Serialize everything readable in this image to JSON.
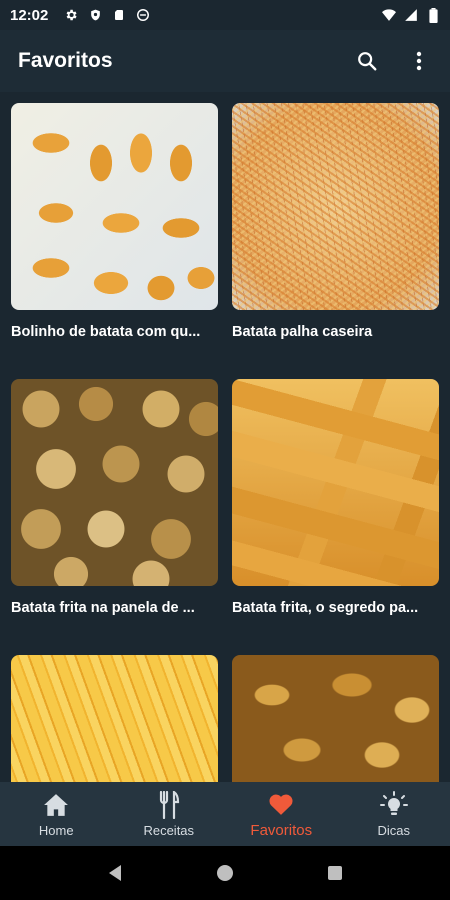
{
  "status_bar": {
    "time": "12:02"
  },
  "app_bar": {
    "title": "Favoritos"
  },
  "recipes": [
    {
      "title": "Bolinho de batata com qu...",
      "image": "img-bolinho"
    },
    {
      "title": "Batata palha caseira",
      "image": "img-palha"
    },
    {
      "title": "Batata frita na panela de ...",
      "image": "img-panela"
    },
    {
      "title": "Batata frita, o segredo pa...",
      "image": "img-segredo"
    },
    {
      "title": "",
      "image": "img-fritas"
    },
    {
      "title": "",
      "image": "img-chips"
    }
  ],
  "bottom_nav": {
    "items": [
      {
        "label": "Home",
        "icon": "home-icon"
      },
      {
        "label": "Receitas",
        "icon": "cutlery-icon"
      },
      {
        "label": "Favoritos",
        "icon": "heart-icon"
      },
      {
        "label": "Dicas",
        "icon": "lightbulb-icon"
      }
    ],
    "active": "Favoritos"
  },
  "colors": {
    "accent": "#f05a3a",
    "background": "#1b2730",
    "app_bar": "#1e2c36",
    "bottom_nav": "#263540"
  }
}
